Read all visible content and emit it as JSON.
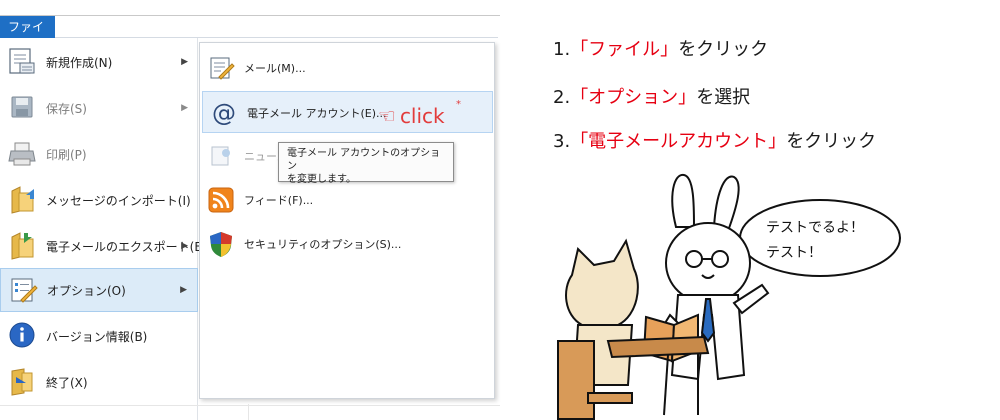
{
  "app": {
    "file_tab": "ファイル",
    "menu_items": [
      {
        "label": "新規作成(N)",
        "icon": "new-document-icon",
        "arrow": true,
        "disabled": false,
        "selected": false
      },
      {
        "label": "保存(S)",
        "icon": "save-icon",
        "arrow": true,
        "disabled": true,
        "selected": false
      },
      {
        "label": "印刷(P)",
        "icon": "printer-icon",
        "arrow": false,
        "disabled": true,
        "selected": false
      },
      {
        "label": "メッセージのインポート(I)",
        "icon": "import-folder-icon",
        "arrow": false,
        "disabled": false,
        "selected": false
      },
      {
        "label": "電子メールのエクスポート(E)",
        "icon": "export-folder-icon",
        "arrow": true,
        "disabled": false,
        "selected": false
      },
      {
        "label": "オプション(O)",
        "icon": "options-icon",
        "arrow": true,
        "disabled": false,
        "selected": true
      },
      {
        "label": "バージョン情報(B)",
        "icon": "info-icon",
        "arrow": false,
        "disabled": false,
        "selected": false
      },
      {
        "label": "終了(X)",
        "icon": "exit-icon",
        "arrow": false,
        "disabled": false,
        "selected": false
      }
    ],
    "submenu_items": [
      {
        "label": "メール(M)...",
        "icon": "mail-options-icon"
      },
      {
        "label": "電子メール アカウント(E)...",
        "icon": "at-sign-icon",
        "hover": true
      },
      {
        "label": "ニュース",
        "icon": "news-icon",
        "partial": true
      },
      {
        "label": "フィード(F)...",
        "icon": "rss-feed-icon"
      },
      {
        "label": "セキュリティのオプション(S)...",
        "icon": "security-shield-icon"
      }
    ],
    "tooltip_lines": [
      "電子メール アカウントのオプション",
      "を変更します。"
    ],
    "click_annotation": "click",
    "colors": {
      "file_tab": "#1e6fc5",
      "selection": "#dcebf8",
      "annotation": "#e23b3b"
    }
  },
  "instructions": [
    {
      "num": "1.",
      "highlight": "「ファイル」",
      "rest": "をクリック"
    },
    {
      "num": "2.",
      "highlight": "「オプション」",
      "rest": "を選択"
    },
    {
      "num": "3.",
      "highlight": "「電子メールアカウント」",
      "rest": "をクリック"
    }
  ],
  "illustration": {
    "speech_lines": [
      "テストでるよ！",
      "テスト！"
    ]
  },
  "colors": {
    "highlight_text": "#e60012"
  }
}
